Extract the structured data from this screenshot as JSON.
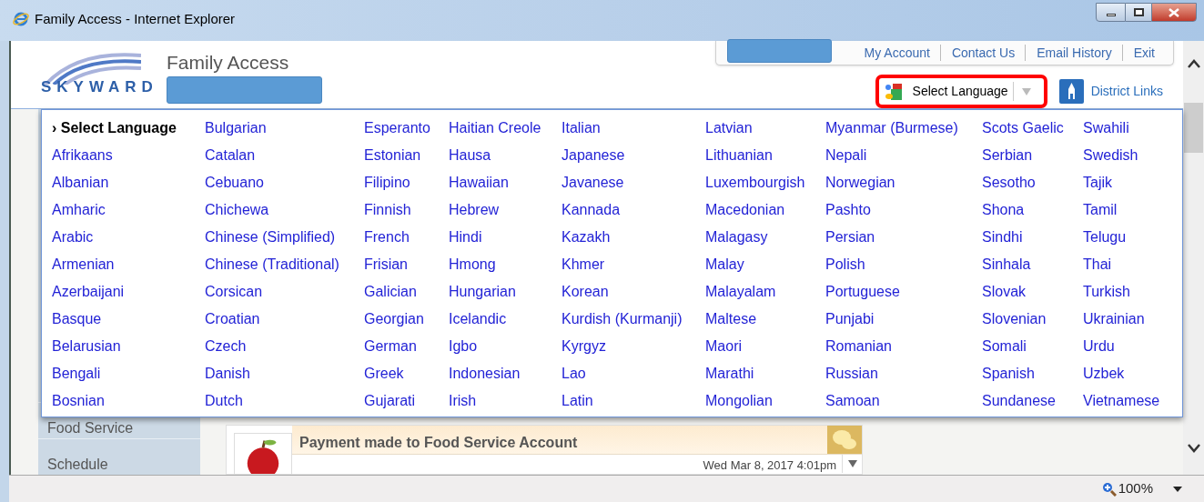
{
  "window": {
    "title": "Family Access - Internet Explorer"
  },
  "header": {
    "logo_text": "SKYWARD",
    "app_title": "Family Access",
    "top_links": [
      "My Account",
      "Contact Us",
      "Email History",
      "Exit"
    ],
    "language_select": {
      "label": "Select Language",
      "highlighted": true
    },
    "district_links": "District Links"
  },
  "language_menu": {
    "columns": [
      [
        {
          "label": "› Select Language",
          "selected": true
        },
        {
          "label": "Afrikaans",
          "selected": false
        },
        {
          "label": "Albanian",
          "selected": false
        },
        {
          "label": "Amharic",
          "selected": false
        },
        {
          "label": "Arabic",
          "selected": false
        },
        {
          "label": "Armenian",
          "selected": false
        },
        {
          "label": "Azerbaijani",
          "selected": false
        },
        {
          "label": "Basque",
          "selected": false
        },
        {
          "label": "Belarusian",
          "selected": false
        },
        {
          "label": "Bengali",
          "selected": false
        },
        {
          "label": "Bosnian",
          "selected": false
        }
      ],
      [
        {
          "label": "Bulgarian",
          "selected": false
        },
        {
          "label": "Catalan",
          "selected": false
        },
        {
          "label": "Cebuano",
          "selected": false
        },
        {
          "label": "Chichewa",
          "selected": false
        },
        {
          "label": "Chinese (Simplified)",
          "selected": false
        },
        {
          "label": "Chinese (Traditional)",
          "selected": false
        },
        {
          "label": "Corsican",
          "selected": false
        },
        {
          "label": "Croatian",
          "selected": false
        },
        {
          "label": "Czech",
          "selected": false
        },
        {
          "label": "Danish",
          "selected": false
        },
        {
          "label": "Dutch",
          "selected": false
        }
      ],
      [
        {
          "label": "Esperanto",
          "selected": false
        },
        {
          "label": "Estonian",
          "selected": false
        },
        {
          "label": "Filipino",
          "selected": false
        },
        {
          "label": "Finnish",
          "selected": false
        },
        {
          "label": "French",
          "selected": false
        },
        {
          "label": "Frisian",
          "selected": false
        },
        {
          "label": "Galician",
          "selected": false
        },
        {
          "label": "Georgian",
          "selected": false
        },
        {
          "label": "German",
          "selected": false
        },
        {
          "label": "Greek",
          "selected": false
        },
        {
          "label": "Gujarati",
          "selected": false
        }
      ],
      [
        {
          "label": "Haitian Creole",
          "selected": false
        },
        {
          "label": "Hausa",
          "selected": false
        },
        {
          "label": "Hawaiian",
          "selected": false
        },
        {
          "label": "Hebrew",
          "selected": false
        },
        {
          "label": "Hindi",
          "selected": false
        },
        {
          "label": "Hmong",
          "selected": false
        },
        {
          "label": "Hungarian",
          "selected": false
        },
        {
          "label": "Icelandic",
          "selected": false
        },
        {
          "label": "Igbo",
          "selected": false
        },
        {
          "label": "Indonesian",
          "selected": false
        },
        {
          "label": "Irish",
          "selected": false
        }
      ],
      [
        {
          "label": "Italian",
          "selected": false
        },
        {
          "label": "Japanese",
          "selected": false
        },
        {
          "label": "Javanese",
          "selected": false
        },
        {
          "label": "Kannada",
          "selected": false
        },
        {
          "label": "Kazakh",
          "selected": false
        },
        {
          "label": "Khmer",
          "selected": false
        },
        {
          "label": "Korean",
          "selected": false
        },
        {
          "label": "Kurdish (Kurmanji)",
          "selected": false
        },
        {
          "label": "Kyrgyz",
          "selected": false
        },
        {
          "label": "Lao",
          "selected": false
        },
        {
          "label": "Latin",
          "selected": false
        }
      ],
      [
        {
          "label": "Latvian",
          "selected": false
        },
        {
          "label": "Lithuanian",
          "selected": false
        },
        {
          "label": "Luxembourgish",
          "selected": false
        },
        {
          "label": "Macedonian",
          "selected": false
        },
        {
          "label": "Malagasy",
          "selected": false
        },
        {
          "label": "Malay",
          "selected": false
        },
        {
          "label": "Malayalam",
          "selected": false
        },
        {
          "label": "Maltese",
          "selected": false
        },
        {
          "label": "Maori",
          "selected": false
        },
        {
          "label": "Marathi",
          "selected": false
        },
        {
          "label": "Mongolian",
          "selected": false
        }
      ],
      [
        {
          "label": "Myanmar (Burmese)",
          "selected": false
        },
        {
          "label": "Nepali",
          "selected": false
        },
        {
          "label": "Norwegian",
          "selected": false
        },
        {
          "label": "Pashto",
          "selected": false
        },
        {
          "label": "Persian",
          "selected": false
        },
        {
          "label": "Polish",
          "selected": false
        },
        {
          "label": "Portuguese",
          "selected": false
        },
        {
          "label": "Punjabi",
          "selected": false
        },
        {
          "label": "Romanian",
          "selected": false
        },
        {
          "label": "Russian",
          "selected": false
        },
        {
          "label": "Samoan",
          "selected": false
        }
      ],
      [
        {
          "label": "Scots Gaelic",
          "selected": false
        },
        {
          "label": "Serbian",
          "selected": false
        },
        {
          "label": "Sesotho",
          "selected": false
        },
        {
          "label": "Shona",
          "selected": false
        },
        {
          "label": "Sindhi",
          "selected": false
        },
        {
          "label": "Sinhala",
          "selected": false
        },
        {
          "label": "Slovak",
          "selected": false
        },
        {
          "label": "Slovenian",
          "selected": false
        },
        {
          "label": "Somali",
          "selected": false
        },
        {
          "label": "Spanish",
          "selected": false
        },
        {
          "label": "Sundanese",
          "selected": false
        }
      ],
      [
        {
          "label": "Swahili",
          "selected": false
        },
        {
          "label": "Swedish",
          "selected": false
        },
        {
          "label": "Tajik",
          "selected": false
        },
        {
          "label": "Tamil",
          "selected": false
        },
        {
          "label": "Telugu",
          "selected": false
        },
        {
          "label": "Thai",
          "selected": false
        },
        {
          "label": "Turkish",
          "selected": false
        },
        {
          "label": "Ukrainian",
          "selected": false
        },
        {
          "label": "Urdu",
          "selected": false
        },
        {
          "label": "Uzbek",
          "selected": false
        },
        {
          "label": "Vietnamese",
          "selected": false
        }
      ]
    ]
  },
  "sidebar": {
    "items": [
      "Food Service",
      "Schedule"
    ]
  },
  "message": {
    "title": "Payment made to Food Service Account",
    "date": "Wed Mar 8, 2017 4:01pm"
  },
  "status_bar": {
    "zoom": "100%"
  }
}
